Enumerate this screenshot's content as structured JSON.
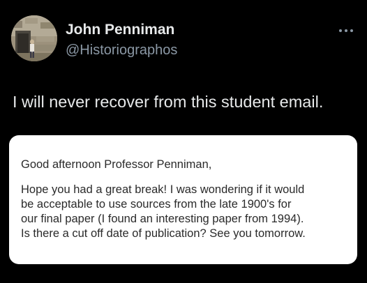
{
  "author": {
    "display_name": "John Penniman",
    "handle": "@Historiographos"
  },
  "more_icon": "more-horizontal-icon",
  "tweet_text": "I will never recover from this student email.",
  "email": {
    "greeting": "Good afternoon Professor Penniman,",
    "body_lines": [
      "Hope you had a great break! I was wondering if it would",
      "be acceptable to use sources from the late 1900's for",
      "our final paper (I found an interesting paper from 1994).",
      "Is there a cut off date of publication? See you tomorrow."
    ]
  },
  "colors": {
    "background": "#000000",
    "primary_text": "#e7e9ea",
    "secondary_text": "#8b98a5",
    "card_background": "#ffffff",
    "card_text": "#2a2a2a"
  }
}
